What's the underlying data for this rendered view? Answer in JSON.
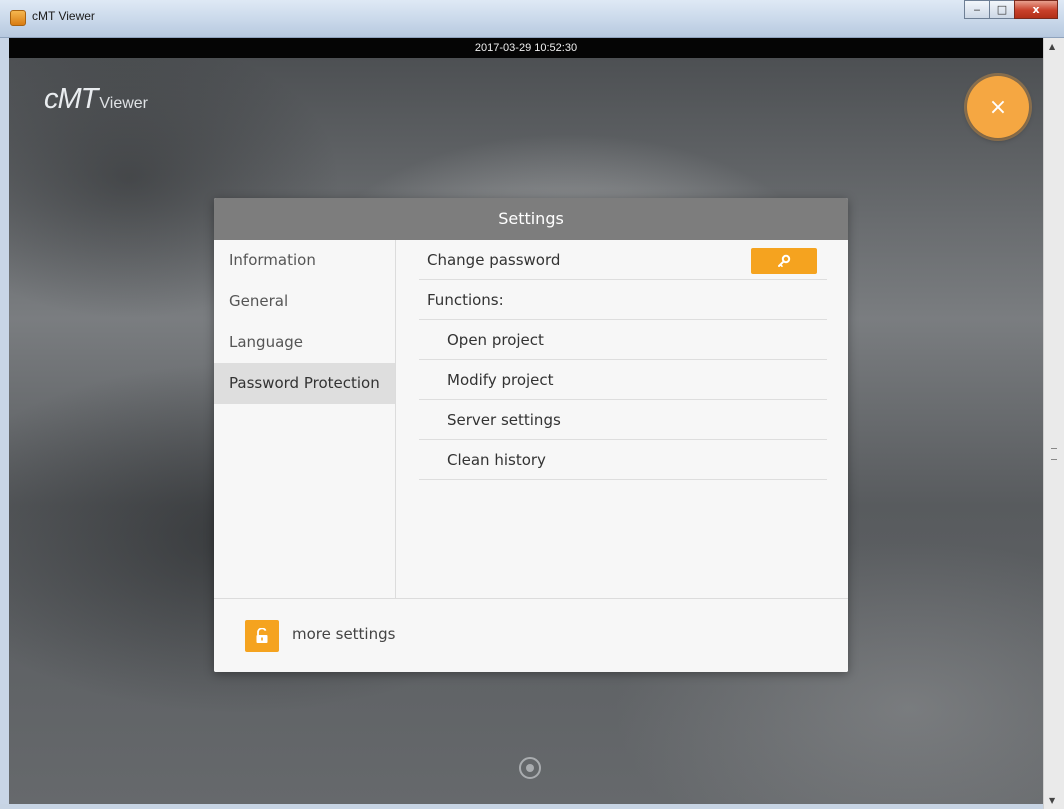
{
  "window": {
    "title": "cMT Viewer",
    "icon": "app-icon",
    "controls": {
      "minimize": "‒",
      "maximize": "□",
      "close": "x"
    }
  },
  "status_bar": {
    "timestamp": "2017-03-29 10:52:30"
  },
  "logo": {
    "main": "cMT",
    "sub": "Viewer"
  },
  "close_fab": {
    "icon": "close-icon",
    "symbol": "×"
  },
  "dialog": {
    "title": "Settings",
    "nav": [
      {
        "label": "Information",
        "active": false
      },
      {
        "label": "General",
        "active": false
      },
      {
        "label": "Language",
        "active": false
      },
      {
        "label": "Password Protection",
        "active": true
      }
    ],
    "rows": {
      "change_password": "Change password",
      "functions": "Functions:",
      "open_project": "Open project",
      "modify_project": "Modify project",
      "server_settings": "Server settings",
      "clean_history": "Clean history"
    },
    "footer": {
      "label": "more settings",
      "icon": "unlock-icon"
    }
  },
  "colors": {
    "accent": "#f5a31f",
    "fab": "#f5a742",
    "header": "#7d7d7d",
    "active_nav": "#dedede"
  }
}
